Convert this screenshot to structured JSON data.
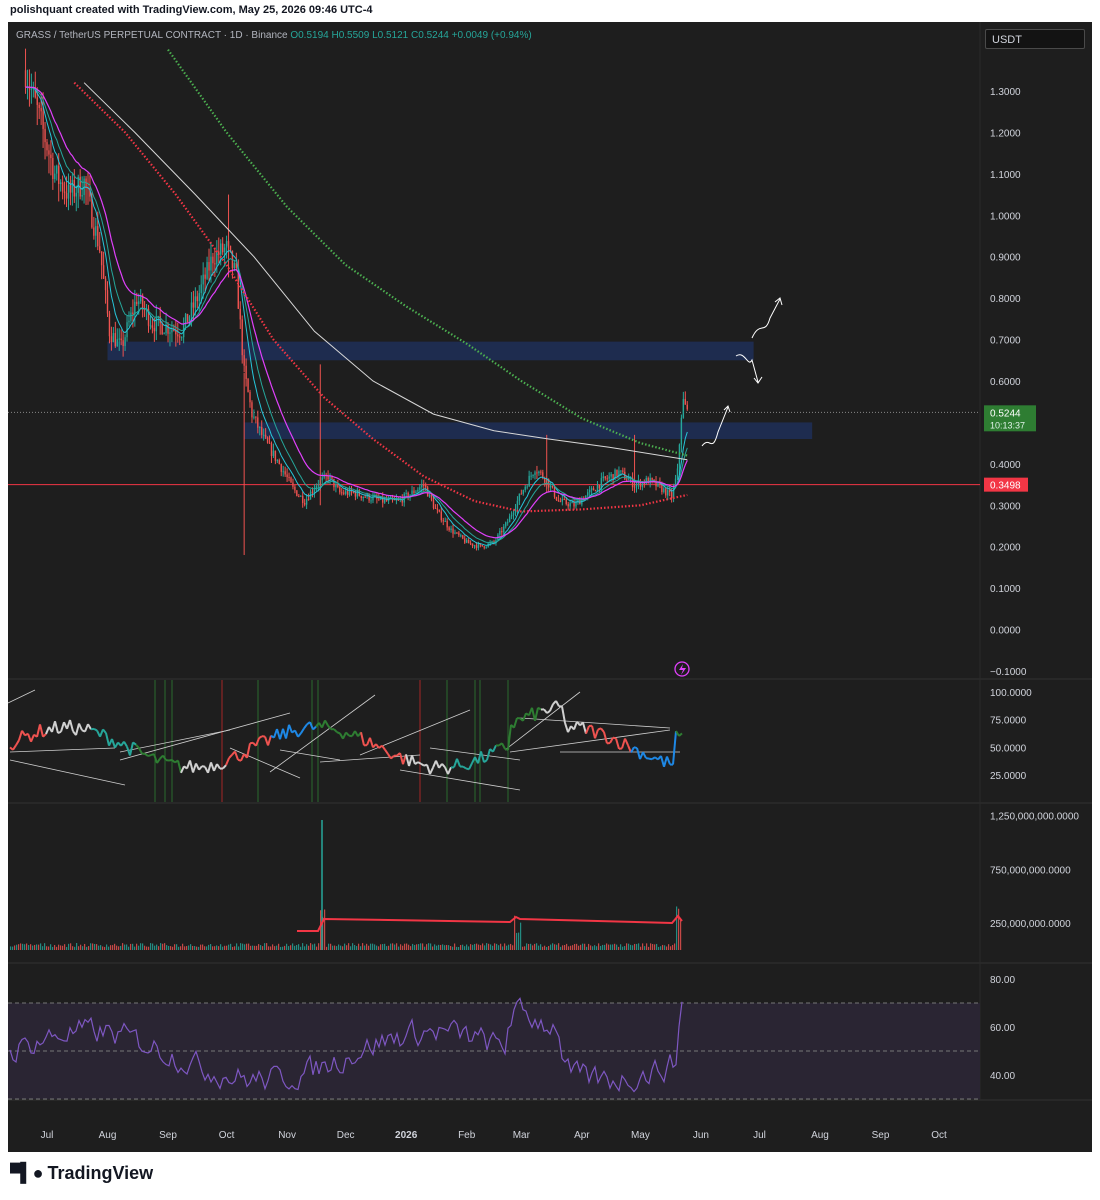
{
  "header": {
    "attribution": "polishquant created with TradingView.com, May 25, 2026 09:46 UTC-4"
  },
  "symbol": {
    "name": "GRASS / TetherUS PERPETUAL CONTRACT · 1D · Binance",
    "open": "O0.5194",
    "high": "H0.5509",
    "low": "L0.5121",
    "close": "C0.5244",
    "change": "+0.0049 (+0.94%)"
  },
  "currency": "USDT",
  "footer": {
    "brand": "TradingView"
  },
  "colors": {
    "up": "#26a69a",
    "down": "#ef5350",
    "ma_fast": "#26c6da",
    "ma_mid": "#e040fb",
    "ma_red": "#f23645",
    "ma_white": "#d8d8d8",
    "ma_green": "#4caf50",
    "zone": "#1f2d52",
    "rsi_line": "#7e57c2",
    "support_line": "#f23645"
  },
  "chart_data": [
    {
      "type": "line",
      "name": "price",
      "x_ticks": [
        "Jul",
        "Aug",
        "Sep",
        "Oct",
        "Nov",
        "Dec",
        "2026",
        "Feb",
        "Mar",
        "Apr",
        "May",
        "Jun",
        "Jul",
        "Aug",
        "Sep",
        "Oct"
      ],
      "y_ticks": [
        "1.3000",
        "1.2000",
        "1.1000",
        "1.0000",
        "0.9000",
        "0.8000",
        "0.7000",
        "0.6000",
        "0.5000",
        "0.4000",
        "0.3000",
        "0.2000",
        "0.1000",
        "0.0000",
        "−0.1000"
      ],
      "ylim": [
        -0.1,
        1.3
      ],
      "price_points": [
        [
          "2025-06-20",
          1.35
        ],
        [
          "2025-06-28",
          1.22
        ],
        [
          "2025-07-05",
          1.1
        ],
        [
          "2025-07-12",
          1.05
        ],
        [
          "2025-07-20",
          1.08
        ],
        [
          "2025-07-28",
          0.92
        ],
        [
          "2025-08-02",
          0.72
        ],
        [
          "2025-08-08",
          0.68
        ],
        [
          "2025-08-16",
          0.8
        ],
        [
          "2025-08-24",
          0.74
        ],
        [
          "2025-09-01",
          0.73
        ],
        [
          "2025-09-08",
          0.72
        ],
        [
          "2025-09-16",
          0.8
        ],
        [
          "2025-09-24",
          0.9
        ],
        [
          "2025-10-01",
          0.92
        ],
        [
          "2025-10-06",
          0.85
        ],
        [
          "2025-10-10",
          0.62
        ],
        [
          "2025-10-14",
          0.52
        ],
        [
          "2025-10-20",
          0.46
        ],
        [
          "2025-10-28",
          0.4
        ],
        [
          "2025-11-04",
          0.34
        ],
        [
          "2025-11-10",
          0.31
        ],
        [
          "2025-11-16",
          0.35
        ],
        [
          "2025-11-22",
          0.37
        ],
        [
          "2025-11-28",
          0.33
        ],
        [
          "2025-12-05",
          0.33
        ],
        [
          "2025-12-12",
          0.32
        ],
        [
          "2025-12-20",
          0.31
        ],
        [
          "2025-12-28",
          0.31
        ],
        [
          "2026-01-04",
          0.33
        ],
        [
          "2026-01-10",
          0.35
        ],
        [
          "2026-01-16",
          0.29
        ],
        [
          "2026-01-24",
          0.24
        ],
        [
          "2026-02-01",
          0.21
        ],
        [
          "2026-02-08",
          0.2
        ],
        [
          "2026-02-15",
          0.21
        ],
        [
          "2026-02-22",
          0.26
        ],
        [
          "2026-03-01",
          0.33
        ],
        [
          "2026-03-08",
          0.39
        ],
        [
          "2026-03-14",
          0.36
        ],
        [
          "2026-03-20",
          0.31
        ],
        [
          "2026-03-28",
          0.3
        ],
        [
          "2026-04-05",
          0.33
        ],
        [
          "2026-04-12",
          0.36
        ],
        [
          "2026-04-20",
          0.38
        ],
        [
          "2026-04-28",
          0.35
        ],
        [
          "2026-05-05",
          0.36
        ],
        [
          "2026-05-12",
          0.34
        ],
        [
          "2026-05-17",
          0.32
        ],
        [
          "2026-05-20",
          0.38
        ],
        [
          "2026-05-22",
          0.52
        ],
        [
          "2026-05-23",
          0.55
        ],
        [
          "2026-05-25",
          0.5244
        ]
      ],
      "moving_averages": [
        {
          "color_key": "ma_green",
          "points": [
            [
              "2025-09-01",
              1.4
            ],
            [
              "2025-10-01",
              1.2
            ],
            [
              "2025-11-01",
              1.02
            ],
            [
              "2025-12-01",
              0.88
            ],
            [
              "2026-01-01",
              0.78
            ],
            [
              "2026-02-01",
              0.69
            ],
            [
              "2026-03-01",
              0.6
            ],
            [
              "2026-04-01",
              0.51
            ],
            [
              "2026-05-01",
              0.45
            ],
            [
              "2026-05-25",
              0.42
            ]
          ]
        },
        {
          "color_key": "ma_white",
          "points": [
            [
              "2025-07-20",
              1.32
            ],
            [
              "2025-08-15",
              1.2
            ],
            [
              "2025-09-15",
              1.05
            ],
            [
              "2025-10-15",
              0.9
            ],
            [
              "2025-11-15",
              0.72
            ],
            [
              "2025-12-15",
              0.6
            ],
            [
              "2026-01-15",
              0.52
            ],
            [
              "2026-02-15",
              0.48
            ],
            [
              "2026-03-15",
              0.46
            ],
            [
              "2026-04-15",
              0.44
            ],
            [
              "2026-05-25",
              0.41
            ]
          ]
        },
        {
          "color_key": "ma_red",
          "points": [
            [
              "2025-07-15",
              1.32
            ],
            [
              "2025-08-10",
              1.2
            ],
            [
              "2025-09-05",
              1.05
            ],
            [
              "2025-10-01",
              0.88
            ],
            [
              "2025-10-25",
              0.7
            ],
            [
              "2025-11-20",
              0.56
            ],
            [
              "2025-12-15",
              0.46
            ],
            [
              "2026-01-10",
              0.37
            ],
            [
              "2026-02-05",
              0.31
            ],
            [
              "2026-03-01",
              0.285
            ],
            [
              "2026-04-01",
              0.29
            ],
            [
              "2026-05-01",
              0.3
            ],
            [
              "2026-05-25",
              0.325
            ]
          ]
        }
      ],
      "zones": [
        {
          "from": "2025-08-01",
          "to": "2026-06-28",
          "y_low": 0.65,
          "y_high": 0.695
        },
        {
          "from": "2025-10-10",
          "to": "2026-07-28",
          "y_low": 0.46,
          "y_high": 0.5
        }
      ],
      "horizontal_line": {
        "value": 0.3498,
        "label": "0.3498"
      },
      "last_price": {
        "value": 0.5244,
        "label": "0.5244",
        "countdown": "10:13:37"
      },
      "projection": [
        [
          "2026-05-28",
          0.47
        ],
        [
          "2026-06-05",
          0.5
        ],
        [
          "2026-06-12",
          0.52
        ],
        [
          "2026-06-20",
          0.64
        ],
        [
          "2026-07-05",
          0.79
        ]
      ]
    },
    {
      "type": "line",
      "name": "oscillator",
      "y_ticks": [
        "100.0000",
        "75.0000",
        "50.0000",
        "25.0000"
      ],
      "ylim": [
        0,
        110
      ]
    },
    {
      "type": "bar",
      "name": "volume",
      "y_ticks": [
        "1,250,000,000.0000",
        "750,000,000.0000",
        "250,000,000.0000"
      ],
      "ylim": [
        0,
        1300000000
      ]
    },
    {
      "type": "line",
      "name": "rsi",
      "y_ticks": [
        "80.00",
        "60.00",
        "40.00"
      ],
      "ylim": [
        20,
        85
      ],
      "bands": [
        70,
        50,
        30
      ]
    }
  ]
}
